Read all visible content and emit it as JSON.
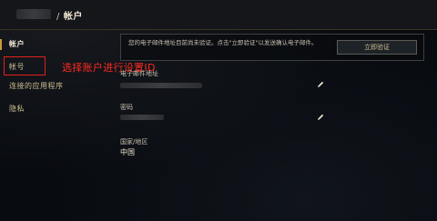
{
  "header": {
    "separator": "/",
    "title": "帐户"
  },
  "sidebar": {
    "items": [
      {
        "label": "帐户"
      },
      {
        "label": "帐号"
      },
      {
        "label": "连接的应用程序"
      },
      {
        "label": "隐私"
      }
    ]
  },
  "annotation": {
    "text": "选择账户进行设置ID",
    "color": "#ff2a20"
  },
  "banner": {
    "message": "您的电子邮件地址目前尚未验证。点击\"立即验证\"以发送确认电子邮件。",
    "button_label": "立即验证"
  },
  "fields": {
    "email_label": "电子邮件地址",
    "password_label": "密码",
    "country_label": "国家/地区",
    "country_value": "中国"
  },
  "colors": {
    "accent": "#c89b3c",
    "highlight_box": "#e0201b"
  }
}
